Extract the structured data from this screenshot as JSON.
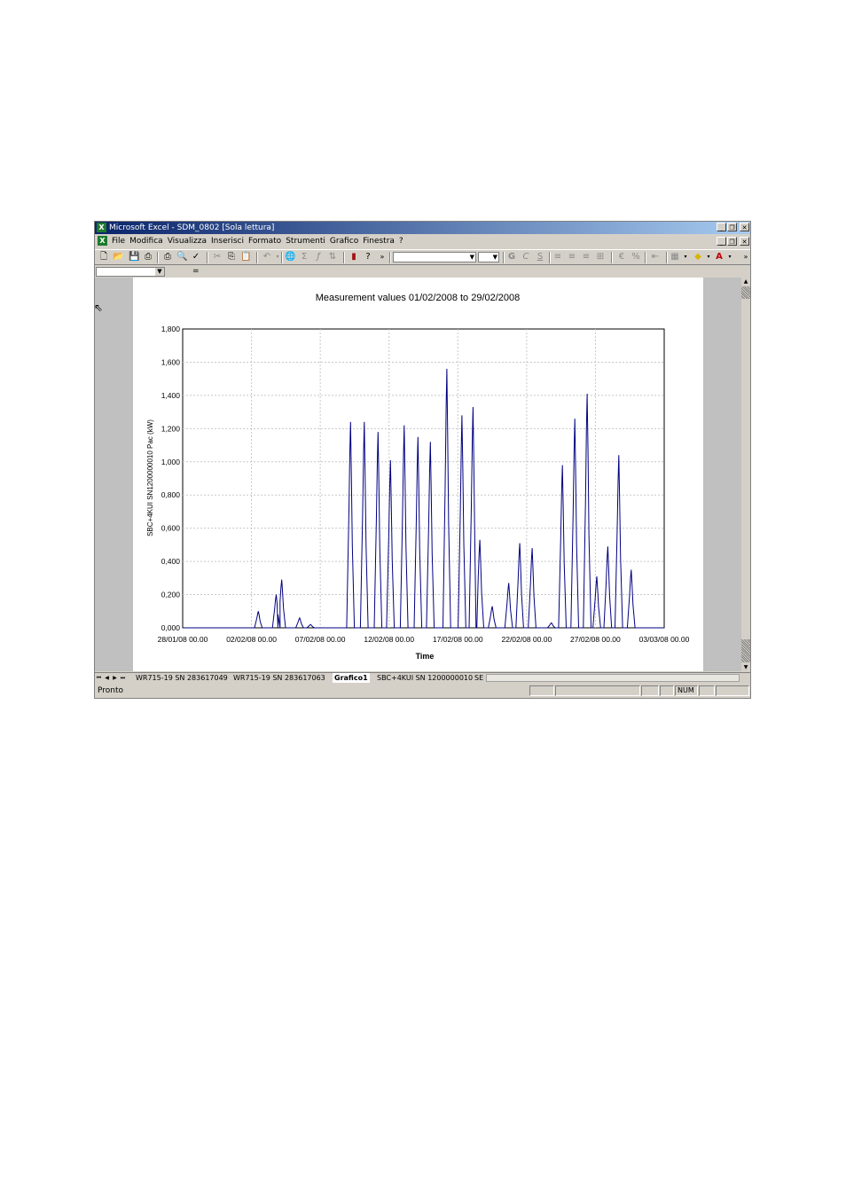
{
  "window": {
    "title": "Microsoft Excel - SDM_0802  [Sola lettura]",
    "app_icon": "excel-icon"
  },
  "menu": {
    "items": [
      "File",
      "Modifica",
      "Visualizza",
      "Inserisci",
      "Formato",
      "Strumenti",
      "Grafico",
      "Finestra",
      "?"
    ]
  },
  "toolbar": {
    "icons": [
      "new-icon",
      "open-icon",
      "save-icon",
      "print-icon",
      "print-preview-icon",
      "spelling-icon",
      "cut-icon",
      "copy-icon",
      "paste-icon",
      "undo-icon",
      "hyperlink-icon",
      "autosum-icon",
      "function-icon",
      "sort-icon",
      "chart-wizard-icon",
      "help-icon",
      "bold-icon",
      "italic-icon",
      "underline-icon",
      "align-left-icon",
      "align-center-icon",
      "align-right-icon",
      "merge-icon",
      "currency-icon",
      "percent-icon",
      "indent-icon",
      "borders-icon",
      "fill-color-icon",
      "font-color-icon"
    ],
    "bold_label": "G",
    "italic_label": "C",
    "underline_label": "S"
  },
  "formula_bar": {
    "equals": "="
  },
  "chart_data": {
    "type": "line",
    "title": "Measurement values 01/02/2008 to 29/02/2008",
    "xlabel": "Time",
    "ylabel": "SBC+4KUI SN1200000010 Pac (kW)",
    "x_ticks": [
      "28/01/08 00.00",
      "02/02/08 00.00",
      "07/02/08 00.00",
      "12/02/08 00.00",
      "17/02/08 00.00",
      "22/02/08 00.00",
      "27/02/08 00.00",
      "03/03/08 00.00"
    ],
    "y_ticks": [
      "0.000",
      "0.200",
      "0.400",
      "0.600",
      "0.800",
      "1.000",
      "1.200",
      "1.400",
      "1.600",
      "1.800"
    ],
    "ylim": [
      0,
      1.8
    ],
    "x_range_days": [
      0,
      35
    ],
    "grid": true,
    "line_color": "#000080",
    "series": [
      {
        "x_days_from_28_01_08": [
          5.5,
          6.8,
          7.2,
          8.5,
          9.3,
          12.2,
          13.2,
          14.2,
          15.1,
          16.1,
          17.1,
          18.0,
          19.2,
          20.3,
          21.1,
          21.6,
          22.5,
          23.7,
          24.5,
          25.4,
          26.8,
          27.6,
          28.5,
          29.4,
          30.1,
          30.9,
          31.7,
          32.6
        ],
        "peak_kW": [
          0.1,
          0.2,
          0.29,
          0.06,
          0.02,
          1.24,
          1.24,
          1.18,
          1.01,
          1.22,
          1.15,
          1.12,
          1.56,
          1.28,
          1.33,
          0.53,
          0.13,
          0.27,
          0.51,
          0.48,
          0.03,
          0.98,
          1.26,
          1.41,
          0.31,
          0.49,
          1.04,
          0.35
        ]
      }
    ]
  },
  "sheet_tabs": [
    "WR715-19 SN 283617049",
    "WR715-19 SN 283617063",
    "Grafico1",
    "SBC+4KUI SN 1200000010",
    "SE"
  ],
  "active_tab": "Grafico1",
  "status": {
    "ready": "Pronto",
    "num": "NUM"
  }
}
